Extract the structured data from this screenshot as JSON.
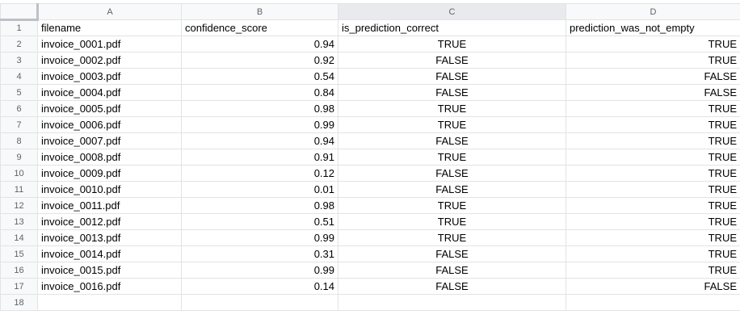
{
  "columns": [
    "A",
    "B",
    "C",
    "D"
  ],
  "header_row": {
    "num": "1",
    "cells": [
      "filename",
      "confidence_score",
      "is_prediction_correct",
      "prediction_was_not_empty"
    ]
  },
  "rows": [
    {
      "num": "2",
      "cells": [
        "invoice_0001.pdf",
        "0.94",
        "TRUE",
        "TRUE"
      ]
    },
    {
      "num": "3",
      "cells": [
        "invoice_0002.pdf",
        "0.92",
        "FALSE",
        "TRUE"
      ]
    },
    {
      "num": "4",
      "cells": [
        "invoice_0003.pdf",
        "0.54",
        "FALSE",
        "FALSE"
      ]
    },
    {
      "num": "5",
      "cells": [
        "invoice_0004.pdf",
        "0.84",
        "FALSE",
        "FALSE"
      ]
    },
    {
      "num": "6",
      "cells": [
        "invoice_0005.pdf",
        "0.98",
        "TRUE",
        "TRUE"
      ]
    },
    {
      "num": "7",
      "cells": [
        "invoice_0006.pdf",
        "0.99",
        "TRUE",
        "TRUE"
      ]
    },
    {
      "num": "8",
      "cells": [
        "invoice_0007.pdf",
        "0.94",
        "FALSE",
        "TRUE"
      ]
    },
    {
      "num": "9",
      "cells": [
        "invoice_0008.pdf",
        "0.91",
        "TRUE",
        "TRUE"
      ]
    },
    {
      "num": "10",
      "cells": [
        "invoice_0009.pdf",
        "0.12",
        "FALSE",
        "TRUE"
      ]
    },
    {
      "num": "11",
      "cells": [
        "invoice_0010.pdf",
        "0.01",
        "FALSE",
        "TRUE"
      ]
    },
    {
      "num": "12",
      "cells": [
        "invoice_0011.pdf",
        "0.98",
        "TRUE",
        "TRUE"
      ]
    },
    {
      "num": "13",
      "cells": [
        "invoice_0012.pdf",
        "0.51",
        "TRUE",
        "TRUE"
      ]
    },
    {
      "num": "14",
      "cells": [
        "invoice_0013.pdf",
        "0.99",
        "TRUE",
        "TRUE"
      ]
    },
    {
      "num": "15",
      "cells": [
        "invoice_0014.pdf",
        "0.31",
        "FALSE",
        "TRUE"
      ]
    },
    {
      "num": "16",
      "cells": [
        "invoice_0015.pdf",
        "0.99",
        "FALSE",
        "TRUE"
      ]
    },
    {
      "num": "17",
      "cells": [
        "invoice_0016.pdf",
        "0.14",
        "FALSE",
        "FALSE"
      ]
    }
  ],
  "empty_row": {
    "num": "18"
  }
}
